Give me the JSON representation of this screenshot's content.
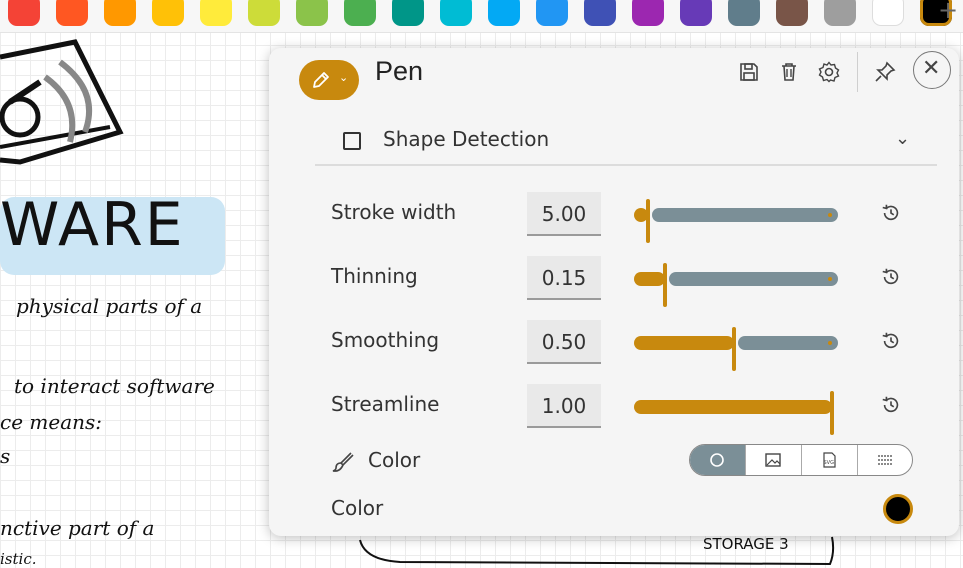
{
  "palette": {
    "colors": [
      "#f44336",
      "#ff5722",
      "#ff9800",
      "#ffc107",
      "#ffeb3b",
      "#cddc39",
      "#8bc34a",
      "#4caf50",
      "#009688",
      "#00bcd4",
      "#03a9f4",
      "#2196f3",
      "#3f51b5",
      "#9c27b0",
      "#673ab7",
      "#607d8b",
      "#795548",
      "#9e9e9e",
      "#ffffff",
      "#000000"
    ],
    "selected_color": "#000000",
    "add_label": "+"
  },
  "notes": {
    "lines": [
      "physical parts of a",
      "to interact software",
      "ce means:",
      "s",
      "nctive part of a",
      "istic."
    ],
    "heading": "WARE",
    "storage_label": "STORAGE 3"
  },
  "panel": {
    "title": "Pen",
    "tool_icon": "pencil-icon",
    "header_icons": [
      "save-icon",
      "delete-icon",
      "settings-icon",
      "pin-icon",
      "close-icon"
    ],
    "shape_detection": {
      "label": "Shape Detection",
      "checked": false
    },
    "settings": [
      {
        "label": "Stroke width",
        "value": "5.00",
        "level": 0.05
      },
      {
        "label": "Thinning",
        "value": "0.15",
        "level": 0.15
      },
      {
        "label": "Smoothing",
        "value": "0.50",
        "level": 0.5
      },
      {
        "label": "Streamline",
        "value": "1.00",
        "level": 1.0
      }
    ],
    "color_section": {
      "label": "Color",
      "modes": [
        "circle-icon",
        "image-icon",
        "svg-icon",
        "pattern-icon"
      ],
      "active_mode": 0
    },
    "color_setting": {
      "label": "Color",
      "value_color": "#000000"
    }
  },
  "accent_color": "#c8890e",
  "track_color": "#7b8f97"
}
